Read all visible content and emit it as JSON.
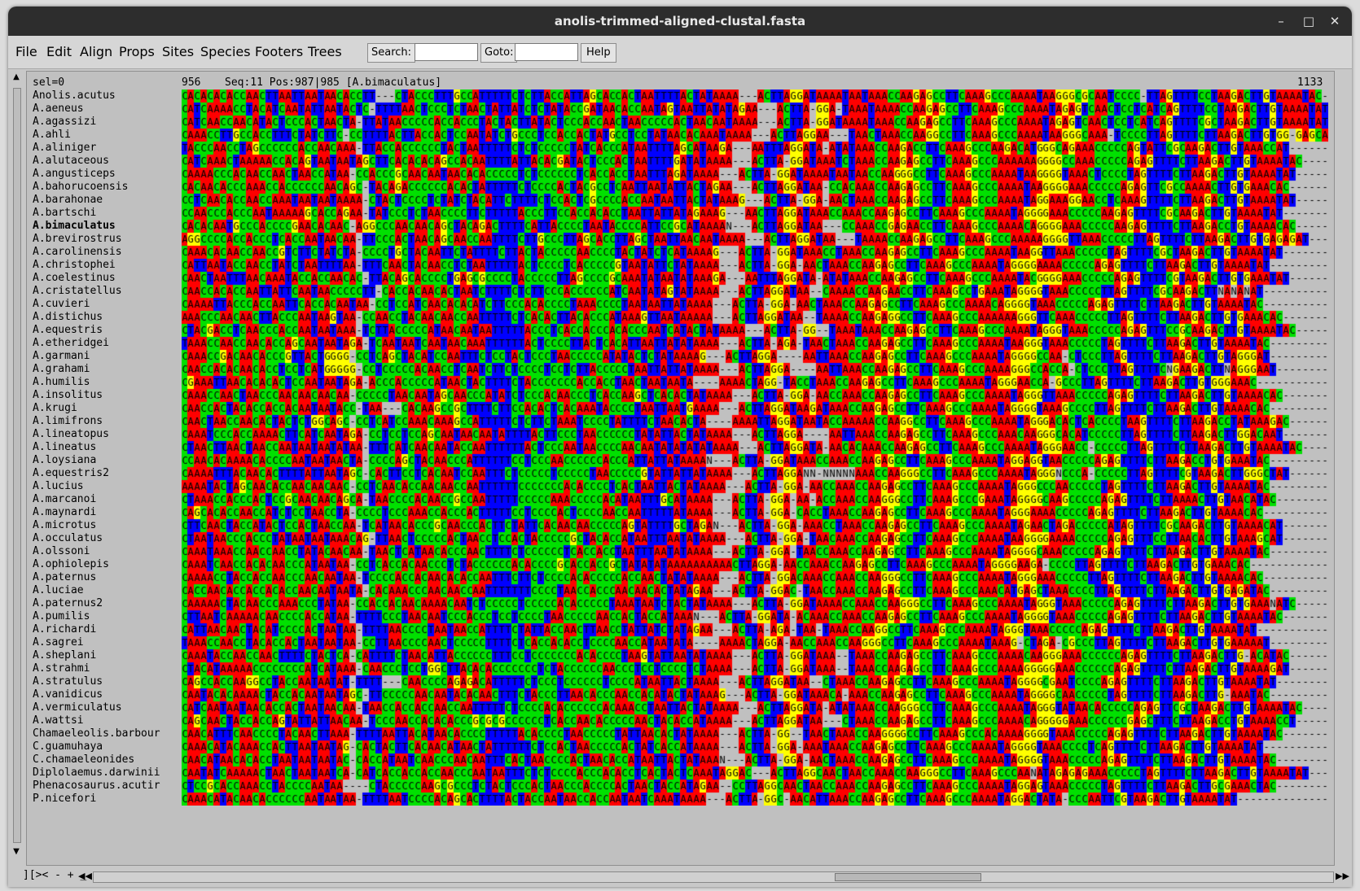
{
  "window": {
    "title": "anolis-trimmed-aligned-clustal.fasta",
    "minimize_label": "–",
    "maximize_label": "□",
    "close_label": "✕"
  },
  "menu": [
    "File",
    "Edit",
    "Align",
    "Props",
    "Sites",
    "Species",
    "Footers",
    "Trees"
  ],
  "search": {
    "label": "Search:",
    "value": ""
  },
  "goto": {
    "label": "Goto:",
    "value": ""
  },
  "help_label": "Help",
  "header": {
    "sel": "sel=0",
    "start": "956",
    "info": "Seq:11 Pos:987|985 [A.bimaculatus]",
    "end": "1133"
  },
  "selected_index": 10,
  "species": [
    "Anolis.acutus",
    "A.aeneus",
    "A.agassizi",
    "A.ahli",
    "A.aliniger",
    "A.alutaceous",
    "A.angusticeps",
    "A.bahorucoensis",
    "A.barahonae",
    "A.bartschi",
    "A.bimaculatus",
    "A.brevirostrus",
    "A.carolinensis",
    "A.christophei",
    "A.coelestinus",
    "A.cristatellus",
    "A.cuvieri",
    "A.distichus",
    "A.equestris",
    "A.etheridgei",
    "A.garmani",
    "A.grahami",
    "A.humilis",
    "A.insolitus",
    "A.krugi",
    "A.limifrons",
    "A.lineatopus",
    "A.lineatus",
    "A.loysiana",
    "A.equestris2",
    "A.lucius",
    "A.marcanoi",
    "A.maynardi",
    "A.microtus",
    "A.occulatus",
    "A.olssoni",
    "A.ophiolepis",
    "A.paternus",
    "A.luciae",
    "A.paternus2",
    "A.pumilis",
    "A.richardi",
    "A.sagrei",
    "A.sheplani",
    "A.strahmi",
    "A.stratulus",
    "A.vanidicus",
    "A.vermiculatus",
    "A.wattsi",
    "Chamaeleolis.barbour",
    "C.guamuhaya",
    "C.chamaeleonides",
    "Diplolaemus.darwinii",
    "Phenacosaurus.acutir",
    "P.nicefori"
  ],
  "sequences": [
    "CACACACACCAACTTAATTAATAACACCTT---CTACCCTTTGCCATTTTTCTCTTACCATTAGCACCACTAATTTTACTATAAAA---ACTTAGGATAAAATAATAAACCAAGAGCCTTCAAAGCCCAAAATAAGGGCGCAATCCCC-TTAGTTTTCCTAAGACTTGTAAAATAC",
    "CATCAAAACCTACATCAATATTAATACTC-TTTTAACTCCCTCTAACTATTATCTCTATACCGATAACACCAATAGTAATTATATAGAA---ACTTA-GGA-TAAATAAAACCAAGAGCCTTCAAAGCCCAAAATAGAGTCAACTCCTCATCAGTTTTCCTAAGACTTGTAAAATAT",
    "CATCAACCAACATACTCCCACTAACTA-TTATAACCCCCACCACCCTACTACTTATACTCCCACCAACTAACCCCCACTAACAATAAAA---ACTTA-GGATAAAATAAACCAAGAGCCTTCAAAGCCCAAAATAGAGTCAACTCCTCATCAGTTTTCGCTAAGACTTGTAAAATAT",
    "CAAACCTTGCCACCTTTCTATCTTC-CCTTTTACTTACCACTCCAATATCTGCCCTCCACCACTATGCCTCCTATAACACAAATAAAA---ACTTAGGAA---TAACTAAACCAAGGCCTTCAAAGCCCAAAATAAGGGCAAA-TCCCCTTAGTTTTCTTAAGACTTGTGG-GAGCA",
    "TACCCAACCTAGCCCCCCACCAACAAA-TTACCACCCCCCTACTAATTTTTCTCTCCCCCTATCACCCATAATTTTAGCATAAGA---AATTTAGGATA-ATATAAACCAAGACCTTCAAAGCCCAAGACATGGGCAGAAACCCCCAGTATTCGCAAGACTTGTAAACCAT",
    "CATCAAACTAAAAACCACAGTAATAATAGCTTCACACACAGCCACAATTTTATTACACGATACTCCCACTAATTTTGATATAAAA---ACTTA-GGATAAATCTAAACCAAGAGCCTTCAAAGCCCAAAAAAGGGGCCAAACCCCCAGAGTTTTCTTAAGACTTGTAAAATAC",
    "CAAAACCCACAACCAACTAACCATAA-CCACCCGCAACAATAACACACCCCCTCTCCCCCCTCACCACCTAATTTAGATAAAA---ACTTA-GGATAAAATAATAACCAAGGGCCTTCAAAGCCCAAAATAAGGGGTAAACTCCCCTAGTTTTCTTAAGACTTGTAAAATAT",
    "CACAACACCCAAACCACCCCCCAACAGC-TACAGACCCCCCACACTATTTTTCTCCCCACTACGCCTCAATTAATATTACTAGAA---ACTTAGGATAA-CCACAAACCAAGAGCCTTCAAAGCCCAAAATAAGGGGAAACCCCCAGAGTTCGCCAAAACTTGTGAAACAC",
    "CCTCAACACCAACCAAATAATAATAAAA-CTACTCCCCTCTATCTACATTCTTTTCTCCACTCGCCCCACCAATAATTACTATAAAG---ACTTA-GGA-AACTAAACCAAGAGCCTTCAAAGCCCAAAATAGGAAAGGAACCTCAAAGTTTTCTTAAGACTTGTAAAATAT",
    "CCAACCCACCCAATAAAAAGCACCAGAA-TATCCCTCTAACCCCTTCTTTTTACCCTTCCACCACACCTAATTATTATAGAAAG---AACTTAGGATAAACCAAACCAAGAGCCTTCAAAGCCCAAAATAGGGGAAACCCCCAAGAGTTTTCGCAAGACTTGTAAAATAT",
    "CACACAATGCCCACCCCGAACACAAC-AGGCCCAACAACAGCTACAGACTTTTCATTACCCCTAATACCCCATTCCGCATAAAAN---ACTTAGGATAA---CCAAACCGAGAACCTTCAAAGCCCAAAACAGGGGAAACCCCCAAGAGTTTTCTTAAGACCTGTAAAACAC",
    "AGGCCCCACCACCCTCACCAATAACAA-TTCCCACTAACAGCAACCAATTTTCTTGCCCTTAGCACCTTAGCTAATTAACAATAAAA---ACTTAGGATAA---TAAAACCAAGAGCCTTCAAAGCCCAAAAAGGGGTTAAACCCCCTTAGTTTTCTTAAGACTTGTGAGAGAT",
    "CAAACACAACCAACCGTCTTCTATCTA-CCCCTGCTACAATTCTATTTTCTTACTACCCCCAACCCCTACTATCTCATAAAAG---ACTTA-GGATAAACCTAAACCAAGAGCCTTCAAAGCCCAAAATAAGGTTAAACCCCCTAGTTTTCGCTAAGACTTGTAAAATAT",
    "CATTAATACCAACCTATCTAATTTTAA-TTTCAACTACAACCTCTAATTTTTACTCCCCTCACCCCCGTAATATTCTATAAAA---ACTTA-GGA-AACTAAACCAAGAGCCTTCAAAGCCCAAAATAGGGGAAAACCCCCAGAGTTTTCTTAAGACTTGTAAAATAT",
    "CAACTAATTTAACAAATACCACCAACAC-TTACAGCACCCCTGAGCGCCCCTACCCCCTTAGCCCCGCAAATATAATATAAAGA---AATTTAGGATA-ATATAAACCAAGAGCCTTCAAAGCCCAAAATACGGGGAAACCCCCAGAGTTTTCGTAAGACTTGTGAAATAT",
    "CAACCACACCAATTATTCAATAACCCCCTT-CACCACAACACTAATCTTTTCTCTTCCCACCCCCCATCAATATAGTATAAAA---ACTTAGGATAA--CAAAACCAAGAACCTTCAAAGCCTGAAATAGGGGTAAACCCCCTTAGTTTTCGCAAGACTTNANANAT",
    "CAAAATTACCCACCAATTCACCACAATAA-CCTCCATCAACACACATCTTCCCACACCCCTAAACCCCTAATAATTATAAAA---ACTTA-GGA-AACTAAACCAAGAGCCTTCAAAGCCCAAAACAGGGGTAAACCCCCAGAGTTTTCTTAAGACTTGTAAAATAC",
    "AAACCCAACAACTTACCCAATAAGTAA-CCAACCTACAACAACCAATTTTTCTCACACTTACACCCATAAAGTTAATAAAAA---ACTTAGGATAA--TAAAACCAAGAGGCCTTCAAAGCCCAAAAAAGGGTTCAAACCCCCTTAGTTTTCTTAAGACTTGTGAAACAC",
    "CTACGACCTCAACCCACCAATAATAAA-TCTTACCCCCATAACAATAATTTTTACCCTCACCACCCACACCCAATCATACTATAAAA---ACTTA-GG--TAAATAAACCAAGAGCCTTCAAAGCCCAAAATAGGGTAAACCCCCAGAGTTTCCGCAAGACTTGTAAAATAC",
    "TAAACCAACCAACACCAGCAATAATAGA-TCAATAATCAATAACAAATTTTTTACTCCCCTTACTCACATTAATTATATAAAA---ACTTA-AGA-TAACTAAACCAAGAGCCTTCAAAGCCCAAAATAAGGGTAAACCCCCTAGTTTTCTTAAGACTTGTAAAATAC",
    "CAAACCGACAACACCCGTTACTGGGG-CCTCAGCTACATCCAATTTCTCCTACTCCCTAACCCCCATATACTCTATAAAAG---ACTTAGGA----AATTAAACCAAGAGCCTTCAAAGCCCAAAATAGGGGCCAA-CTCCCTTAGTTTTCTTAAGACTTGTAGGGAT",
    "CAACCACACAACACCTCCTCATGGGGG-CCTCCCCCACAACCTCAATCTTCTCCCCTCCTCTTACCCCCTAATTATTATAAAA---ACTTAGGA----AATTAAACCAAGAGCCTTCAAAGCCCAAAAGGGCCACCA-CTCCCTTAGTTTTCNGAAGACTTNAGGGAAT",
    "CGAAATTAACACACACTCCAATAATAGA-ACCCACCCCCATAACTACTTTTCTACCCCCCCACCACCTAACTAATAATA----AAAACTAGG-TACCTAAACCAAGAGCCTTCAAAGCCCAAAATAGGGAACCA-GCCCTTAGTTTTCTTAAGACTTGTGGGAAAC",
    "CAAACCAACTAACCCAACAACAACAA-CCCCCTAACAATAGCAACCCATATCTCCCACAACCCTCACCAAGCTCACACTATAAAA---ACTTA-GGA-AACCAAACCAAGAGCCTTCAAAGCCCAAAATAGGGTTAAACCCCCAGAGTTTTCTTAAGACTTGTAAAACAC",
    "CAACCACTACACCACCACAATAATACC-TAA---CACAAGCCGCTTTTCTTCCACACTCACAAATACCCCTAATTAATGAAAA---ACTTAGGATAAGATAAACCAAGAGCCTTCAAAGCCCAAAATAGGGGTAAAGCCCCTTAGTTTTCTTAAGACTTGTAAAACAC",
    "CAACTAACCAACACTACTCTGGCAGC-CCTCATCCAAACAAAGCCATTTTTCTCTTCTAAATCCCCTATTTTCTAACACTA----AAAATTAGGATAATACCAAAAACCAAGGCCTTCAAAGCCCAAAATAGGGACACTCACCCCTAAGTTTTCTTAAGACCTATAAAGAC",
    "CAAATCCCACCAAAACTTCATCAATAGA-CCTCCTCCAGCAATAACAATATTTTACTTCCCTAACCCCCCTATATTACTATAAAA---ACTTAGGA----AATTAAACCAAGAGCCTTCAAAGCCCAAACAAGGGCACATCCCCCTTAGTTTTCTTAAGACTTGGACAAT",
    "CTAACTTAACTAACCAATAATAATATAA-TTTCATCAACAATACCAATTTTTTACTCCCAATAACCCCAACAATATATATATAAAA---ACTTAGGATA-AACACAAACCAAGAGCCTTCAAAGCCCAAAATAGGGAACC-CCCCCTTAGTTTTCTTAAGACTTGTAAAATAC",
    "CCAACACAAAACACCCCAATAATAACTA-CCCCAGCTACAACCCATTTTTTCCTCCCAACCCCCCACCCATTATTATAAAAN---ACTTA-GGATAAACCAAACCAAGAGCCTTCAAAGCCCAAAATAGGAGGTAACCCCCAGAGTTTTCTTAAGACCTGTGAAATAC",
    "CAAAATTTACAACACTTTTATTAATAGC-CACTTCCTCACAATCCAATTTCTCCCCCTCCCCCTAACCCCCGTATTATTATAAAA---ACTTAGGANN-NNNNNAAACCAAGGGCCTTCAAAGCCCAAAATAGGGNCCCA-CCCCCTTAGTTTTCGTAAGACTTGGGCTAT",
    "AAAATACTAGCAACACCAACAACAAC-CCTCAACACCAACAACCAATTTTTTCCCCCCCACACCCCTCACTAATTACTATAAAA---ACTTA-GGA-AACCAAACCAAGAGCCTTCAAAGCCCAAAATAGGGCCCAACCCCCTAGTTTTCTTAAGACTTGTAAAATAC",
    "CTAAACCACCCACTCCGCAACAACAGCA-TAACCCCACAACCGCCAATTTTTCCCCCAAACCCCCACATAATTTGCATAAAA---ACTTA-GGA-AA-ACCAAACCAAGGGCCTTCAAAGCCCGAAATAGGGGCAAGCCCCCAGAGTTTTCTTAAAACTTGTAACATAC",
    "CAGCACACCAACCATCTCCTAACCTA-CCCCTCCCAAACCACCCACTTTTTCCTCCCCACTCCCCAACCAATTTTTATAAAA---ACTTA-GGA-CACCTAAACCAAGAGCCTTCAAAGCCCAAAATAGGGAAAACCCCCAGAGTTTTCTTAAGACTTGTAAAACAC",
    "CTTCAACTACCATACTCCACTAACCAA-TCATAACACCCGCAACCCACTTCTATTCACAACAACCCCCAGTATTTTGCTAGAN---ACTTA-GGA-AAACCTAAACCAAGAGCCTTCAAAGCCCAAAATAGAACTAGACCCCCATAGTTTTCGCAAGACTTGTAAAACAT",
    "CTAATAACCCACCCTATAATAATAAACAG-TTAACTCCCCCACTAACCTCCACTACCCCCGCTACACCATAATTTAATATAAAA---ACTTA-GGA-TAACAAACCAAGAGCCTTCAAAGCCCAAAATAAGGGGAAAACCCCCAGAGTTTCCTTAACACTTGTAAAGCAT",
    "CAAATAAACCAACCAACCTATACAACAA-TAACTCATAACACCCAACTTTTCTCCCCCCTCACCACCTAATTTAATATAAAA---ACTTA-GGA-TAACCAAACCAAGAGCCTTCAAAGCCCAAAATAGGGGCAAACCCCCAGAGTTTTCTTAAGACTTGTAAAATAC",
    "CAAATCAACCACACAACCCATAATAA-CCTCACCACAACCCTCTACCCCCCACACCCCGCACCACCGCTATATATAAAAAAAAAACTTAGGA-AACCAAACCAAGAGCCTTCAAAGCCCAAAATAGGGGAAGA-CCCCTTAGTTTTCTTAAGACTTGTGAAACAC",
    "CAAAACCTACCACCAACCCAACAATAA-TCCCCACCACAACACACCAATTTCTTCTCCCCACACCCCCACCAACTATATAAAA---ACTTA-GGACAAACCAAACCAAGGGCCTTCAAAGCCCAAAATAGGGAAACCCCCTTAGTTTTCTTAAGACTTGTAAAACAC",
    "CACCAACACCACCACACCAACAATAATA-CACAAACCCAACAACCAATTTTTTTCCCCTAACCACCCAACAACACTATAGAA---ACTTA-GGAC-TAACCAAACCAAGAGCCTTCAAAGCCCAAACATGAGCTAAACCCCTTAGTTTTCTTAAGACTTGTGAGATAC",
    "CAAAAACTACAACCCAAACCCTATAA-CCACCACAACAAAACAATCTCCCCCTCCCCCACACCCCCTAAATAATCTACTATAAAA---ACTTA-GGATAAAACCAAACCAAGGGCCTTCAAAGCCCAAAATAGGGTAAACCCCCAGAGTTTTCTTAAGACTTGTGAAANATC",
    "CTTAATCAAAAACAACCCCACCATAA-TTTTCCCTAACAATCCCACCCTCCTCCCCTAACCCCCAACCACTACCATAAAN---ACTTA-GGATA-ACAAACCAAACCAAGAGCCTTCAAAGCCCAAAATAGGGGTAAACCCCCAGAGTTTTCTTAAGACTTGTAAAATAC",
    "CATTAACAACTACATCCCCACTAATAA-TTTTAACCCCTAATAACCATTTTCTATTACCAACTTAACCTATTATCTATAGAA---ACTTA-AGA-TAA-TAAACCAAGGCCTTCAAAGCCCAAAATAGGGTAAACCCCCAGAGTTTTCTTAAGACTTGTAAAATAT",
    "TAAACCAACCTACACCACTAATAATAA-CCTTAACCCCAACTCCCCCTTTTCTCACCACACCTCCCCAACCATAATATA----AAAACTAGGA-AACCAAACCAAGGGCCTTCAAAGCCCAAAATAAAG-CTAGA-CGCCCTTAGTTTTCTTAAGACTTGTGAAAAAT",
    "CAAATACCAACCAACTTTTCTACTCA-CATTTTCTAACATTACCCCCCTTTCCTCCCCCCCACACCCCTAAGTATTAATATAAAA---ACTTA-GGATAAA--TAAACCAAGAGCCTTCAAAGCCCAAAACAAGGGAAACCCCCCAGAGTTTTCTTAAGACTTG-ACATAC",
    "CTACATAAAAACCCCCCCCATCATAAA-CAACCCTCCTGGCTTACACACCCCCCCTCTACCCCCCAACCCTCCTCCCCTCTAAAA---ACTTA-GGATAAA--TAAACCAAGAGCCTTCAAAGCCCAAAAGGGGGAAACCCCCCAGAGTTTTCTTAAGACTTGTAAAAGAT",
    "CAGCCACCAAGGCCTACCAATAATAT-TTTT---CAACCCCAGAGACATTTTTCTCCCTCCCCCCTCCCCATAATTACTAAAA---ACTTAGGATAA--CTAAACCAAGAGCCTTCAAAGCCCAAAATAGGGGCGAATCCCCAGAGTTTTCTTAAGACTTGTAAAATAT",
    "CAATACACAAAACTACCACAATAATAGC-TTCCCCCAACAATACACAACTTTCTACCCTTAACACCCAACCACATACTATAAAG---ACTTA-GGATAAACA-AAACCAAGAGCCTTCAAAGCCCAAAATAGGGGCAACCCCCTAGTTTTCTTAAGACTTG-AAATAC",
    "CATCAATAATAACACCACTAATAACAA-TAACCACCACCAACCAATTTTTCTCCCCACACCCCCCACAAACCTAATTACTATAAAA---ACTTAGGATA-ATATAAACCAAGGGCCTTCAAAGCCCAAAATAGGGTATAACACCCCCAGAGTTCGCTAAGACTTGTAAAATAC",
    "CAGCAACTACCACCAGTATTATTAACAA-TCCCAACCACACACCCGCGCGCCCCCCTCACCAACACCCCCAACTACACCATAAAA---ACTTAGGATAA---CTAAACCAAGAGCCTTCAAAGCCCAAAACAGGGGGAAACCCCCCGAGCTTTCTTAAGACCTGTAAAACCT",
    "CAACATTTCAACCCCTACAACTTAAA-TTTTAATTACATAACACCCCTTTTTACACCCCTAACCCCCTATTAACACTATAAAA---ACTTA-GG--TAACTAAACCAAGGGGCCTTCAAAGCCCACAAAAGGGGTAAACCCCCAGAGTTTTCTTAAGACTTGTAAAATAC",
    "CAAACATACAAACCACTTAATAATAG-CACTACTTCACAACATAACTATTTTTTCTCCACTAACCCCCACTATCACCATAAAA---ACTTA-GGA-AAATAAACCAAGAGCCTTCAAAGCCCAAAATAGGGGTAAACCCCTCAGTTTTCTTAAGACTTGTAAAATAT",
    "CAACATAACACACCTAATAATAATAC-CACCATAATCAACCCAACAATTTCACTAACCCCACTAACACCATAATTACTATAAAN---ACTTA-GGA-AACTAAACCAAGAGCCTTCAAAGCCCAAAATAGGGGTAAACCCCCAGAGTTTTCTTAAGACTTGTAAAATAC",
    "CAATATCAAAAACTAACTAATAATCA-CATCACCACCACCAACCCAATAATTTCTCTCCCCACCCACACCTCACTACTCAAATAGGAC---ACTTAGGCAACTAACCAAACCAAGGGCCTTCAAAGCCCAANATAGAGAGAAACCCCCTAGTTTTCTTAAGACTTGTAAAATAT",
    "CTCCGCACCAAACCTACCCCAATAA----CTACCCCCAAGCGCCCTCTACTCCCACTAACCCACCCCACTAACTACCATAGAA--CCTTAGGCAACTAACCAAACCAAGAGCCTTCAAAGCCCAAAATAGGAGTAAACCCCCTAGTTTTCTTAAGACTTGCGAAACTAC",
    "CAAACATACAACACCCCCCAATAATAA-TTTTAATCCCCACAGCACTTTTACTACCAATAACCACCAATAATCAAATAAAA---ACTTA-GGC-AACATTAAACCAAGAGCCTTCAAAGCCCAAAATAGGACTATA-CCCAATTCGTAAGACTTGTAAAATAT"
  ],
  "status": {
    "text": "][>< - + _"
  },
  "colors": {
    "A": "#ff0000",
    "C": "#00e000",
    "G": "#ffff00",
    "T": "#0000ff",
    "gap": "#c0c0c0",
    "N": "#c0c0c0",
    "titlebar": "#2d2d2d",
    "panel": "#c0c0c0"
  }
}
